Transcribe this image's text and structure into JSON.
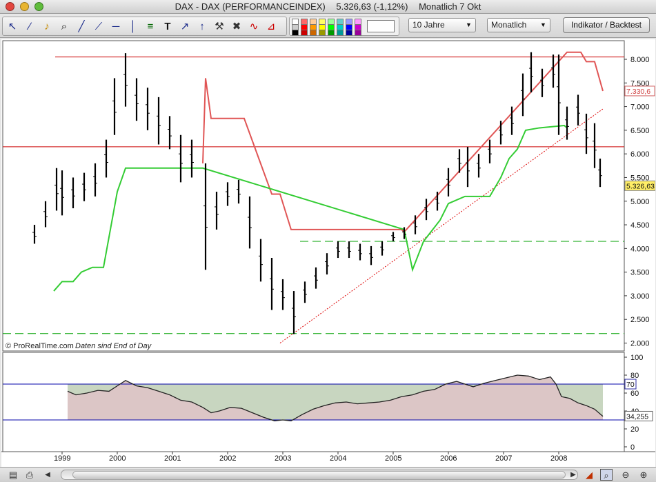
{
  "window": {
    "instrument": "DAX - DAX (PERFORMANCEINDEX)",
    "last_change": "5.326,63 (-1,12%)",
    "period_date": "Monatlich  7 Okt"
  },
  "toolbar": {
    "tools": [
      "cursor-icon",
      "ruler-icon",
      "alarm-bell-icon",
      "zoom-icon",
      "segment-icon",
      "trendline-icon",
      "horizontal-line-icon",
      "vertical-line-icon",
      "fibonacci-icon",
      "text-icon",
      "arrow-icon",
      "arrow-up-icon",
      "tools-icon",
      "trash-icon",
      "indicator-icon",
      "channel-icon"
    ],
    "swatch_colors": [
      "#ffffff",
      "#ff6666",
      "#ffcc99",
      "#ffff66",
      "#99ff99",
      "#66cccc",
      "#9999ff",
      "#ff99ff",
      "#cccccc",
      "#ff0000",
      "#ff9900",
      "#ffff00",
      "#00ff00",
      "#00cccc",
      "#0000ff",
      "#cc00cc",
      "#000000",
      "#cc0000",
      "#cc6600",
      "#999900",
      "#009900",
      "#009999",
      "#000099",
      "#990099"
    ],
    "range_select": "10 Jahre",
    "period_select": "Monatlich",
    "indicator_button": "Indikator / Backtest"
  },
  "chart_data": [
    {
      "type": "line",
      "title": "",
      "ylim": [
        2000,
        8300
      ],
      "y_ticks": [
        "2.000",
        "2.500",
        "3.000",
        "3.500",
        "4.000",
        "4.500",
        "5.000",
        "5.500",
        "6.000",
        "6.500",
        "7.000",
        "7.500",
        "8.000"
      ],
      "x_ticks": [
        "1999",
        "2000",
        "2001",
        "2002",
        "2003",
        "2004",
        "2005",
        "2006",
        "2007",
        "2008"
      ],
      "price_label": "5.326,63",
      "stop_label": "7.330,6",
      "watermark": "© ProRealTime.com",
      "note": "Daten sind End of Day",
      "colors": {
        "price": "#000000",
        "upper_stop": "#e05555",
        "lower_stop": "#33cc33",
        "resistance": "#cc0000",
        "support": "#00a000",
        "trend": "#dd0000"
      },
      "price_bars": [
        {
          "date": "1998.5",
          "high": 4500,
          "low": 4100
        },
        {
          "date": "1998.7",
          "high": 5000,
          "low": 4450
        },
        {
          "date": "1998.9",
          "high": 5700,
          "low": 4800
        },
        {
          "date": "1999.0",
          "high": 5650,
          "low": 4700
        },
        {
          "date": "1999.2",
          "high": 5500,
          "low": 4850
        },
        {
          "date": "1999.4",
          "high": 5600,
          "low": 5000
        },
        {
          "date": "1999.6",
          "high": 5800,
          "low": 5100
        },
        {
          "date": "1999.8",
          "high": 6300,
          "low": 5500
        },
        {
          "date": "1999.95",
          "high": 7600,
          "low": 6400
        },
        {
          "date": "2000.15",
          "high": 8130,
          "low": 7000
        },
        {
          "date": "2000.35",
          "high": 7600,
          "low": 6700
        },
        {
          "date": "2000.55",
          "high": 7400,
          "low": 6500
        },
        {
          "date": "2000.75",
          "high": 7200,
          "low": 6200
        },
        {
          "date": "2000.95",
          "high": 6800,
          "low": 6100
        },
        {
          "date": "2001.15",
          "high": 6400,
          "low": 5400
        },
        {
          "date": "2001.35",
          "high": 6300,
          "low": 5500
        },
        {
          "date": "2001.6",
          "high": 5800,
          "low": 3550
        },
        {
          "date": "2001.8",
          "high": 5200,
          "low": 4400
        },
        {
          "date": "2002.0",
          "high": 5400,
          "low": 4900
        },
        {
          "date": "2002.2",
          "high": 5450,
          "low": 4950
        },
        {
          "date": "2002.4",
          "high": 5100,
          "low": 4000
        },
        {
          "date": "2002.6",
          "high": 4200,
          "low": 3300
        },
        {
          "date": "2002.8",
          "high": 3800,
          "low": 2700
        },
        {
          "date": "2003.0",
          "high": 3350,
          "low": 2700
        },
        {
          "date": "2003.2",
          "high": 3100,
          "low": 2190
        },
        {
          "date": "2003.4",
          "high": 3300,
          "low": 2850
        },
        {
          "date": "2003.6",
          "high": 3600,
          "low": 3150
        },
        {
          "date": "2003.8",
          "high": 3900,
          "low": 3450
        },
        {
          "date": "2004.0",
          "high": 4150,
          "low": 3800
        },
        {
          "date": "2004.2",
          "high": 4150,
          "low": 3800
        },
        {
          "date": "2004.4",
          "high": 4100,
          "low": 3750
        },
        {
          "date": "2004.6",
          "high": 4050,
          "low": 3650
        },
        {
          "date": "2004.8",
          "high": 4150,
          "low": 3850
        },
        {
          "date": "2005.0",
          "high": 4350,
          "low": 4150
        },
        {
          "date": "2005.2",
          "high": 4450,
          "low": 4200
        },
        {
          "date": "2005.4",
          "high": 4700,
          "low": 4300
        },
        {
          "date": "2005.6",
          "high": 5050,
          "low": 4600
        },
        {
          "date": "2005.8",
          "high": 5200,
          "low": 4800
        },
        {
          "date": "2006.0",
          "high": 5700,
          "low": 5100
        },
        {
          "date": "2006.2",
          "high": 6100,
          "low": 5600
        },
        {
          "date": "2006.35",
          "high": 6150,
          "low": 5300
        },
        {
          "date": "2006.55",
          "high": 6000,
          "low": 5500
        },
        {
          "date": "2006.75",
          "high": 6300,
          "low": 5800
        },
        {
          "date": "2006.95",
          "high": 6700,
          "low": 6200
        },
        {
          "date": "2007.15",
          "high": 7000,
          "low": 6400
        },
        {
          "date": "2007.35",
          "high": 7700,
          "low": 6800
        },
        {
          "date": "2007.5",
          "high": 8150,
          "low": 7300
        },
        {
          "date": "2007.7",
          "high": 7800,
          "low": 7200
        },
        {
          "date": "2007.9",
          "high": 8100,
          "low": 7400
        },
        {
          "date": "2008.0",
          "high": 8100,
          "low": 6400
        },
        {
          "date": "2008.15",
          "high": 7000,
          "low": 6300
        },
        {
          "date": "2008.35",
          "high": 7250,
          "low": 6600
        },
        {
          "date": "2008.5",
          "high": 6850,
          "low": 6000
        },
        {
          "date": "2008.65",
          "high": 6650,
          "low": 5700
        },
        {
          "date": "2008.75",
          "high": 5900,
          "low": 5300
        }
      ],
      "upper_stop": [
        [
          "2001.55",
          5800
        ],
        [
          "2001.6",
          7600
        ],
        [
          "2001.7",
          6750
        ],
        [
          "2002.3",
          6750
        ],
        [
          "2002.8",
          5150
        ],
        [
          "2002.95",
          5150
        ],
        [
          "2003.15",
          4400
        ],
        [
          "2005.15",
          4400
        ],
        [
          "2005.2",
          4350
        ],
        [
          "2008.15",
          8150
        ],
        [
          "2008.4",
          8150
        ],
        [
          "2008.5",
          7950
        ],
        [
          "2008.65",
          7950
        ],
        [
          "2008.8",
          7330
        ]
      ],
      "lower_stop": [
        [
          "1998.85",
          3100
        ],
        [
          "1999.0",
          3300
        ],
        [
          "1999.2",
          3300
        ],
        [
          "1999.35",
          3500
        ],
        [
          "1999.55",
          3600
        ],
        [
          "1999.75",
          3600
        ],
        [
          "2000.0",
          5200
        ],
        [
          "2000.15",
          5700
        ],
        [
          "2001.55",
          5700
        ],
        [
          "2005.2",
          4400
        ],
        [
          "2005.35",
          3550
        ],
        [
          "2005.55",
          4150
        ],
        [
          "2005.85",
          4600
        ],
        [
          "2006.0",
          4950
        ],
        [
          "2006.3",
          5100
        ],
        [
          "2006.75",
          5100
        ],
        [
          "2006.95",
          5500
        ],
        [
          "2007.1",
          5900
        ],
        [
          "2007.25",
          6100
        ],
        [
          "2007.4",
          6500
        ],
        [
          "2007.65",
          6550
        ],
        [
          "2008.1",
          6600
        ],
        [
          "2008.15",
          6550
        ]
      ],
      "resistance_lines": [
        8050,
        6150
      ],
      "support_lines": [
        4150,
        2200
      ],
      "trendline": [
        [
          "2002.95",
          2000
        ],
        [
          "2008.8",
          6950
        ]
      ]
    },
    {
      "type": "area",
      "title": "",
      "ylim": [
        0,
        100
      ],
      "y_ticks": [
        "0",
        "20",
        "40",
        "60",
        "80",
        "100"
      ],
      "levels": [
        70,
        30
      ],
      "level_label": "70",
      "value_label": "34,255",
      "colors": {
        "line": "#222222",
        "above": "#c8d6c0",
        "below": "#dcc6c6",
        "level": "#0000aa"
      },
      "values": [
        [
          "1999.1",
          62
        ],
        [
          "1999.25",
          58
        ],
        [
          "1999.45",
          60
        ],
        [
          "1999.65",
          63
        ],
        [
          "1999.85",
          62
        ],
        [
          "2000.05",
          70
        ],
        [
          "2000.15",
          74
        ],
        [
          "2000.35",
          68
        ],
        [
          "2000.55",
          66
        ],
        [
          "2000.75",
          62
        ],
        [
          "2000.95",
          58
        ],
        [
          "2001.15",
          52
        ],
        [
          "2001.35",
          50
        ],
        [
          "2001.55",
          44
        ],
        [
          "2001.7",
          38
        ],
        [
          "2001.85",
          40
        ],
        [
          "2002.05",
          44
        ],
        [
          "2002.25",
          43
        ],
        [
          "2002.45",
          38
        ],
        [
          "2002.65",
          33
        ],
        [
          "2002.85",
          29
        ],
        [
          "2003.0",
          30
        ],
        [
          "2003.15",
          29
        ],
        [
          "2003.35",
          36
        ],
        [
          "2003.55",
          42
        ],
        [
          "2003.75",
          46
        ],
        [
          "2003.95",
          49
        ],
        [
          "2004.15",
          50
        ],
        [
          "2004.35",
          48
        ],
        [
          "2004.55",
          49
        ],
        [
          "2004.75",
          50
        ],
        [
          "2004.95",
          52
        ],
        [
          "2005.15",
          56
        ],
        [
          "2005.35",
          58
        ],
        [
          "2005.55",
          62
        ],
        [
          "2005.75",
          64
        ],
        [
          "2005.95",
          70
        ],
        [
          "2006.15",
          73
        ],
        [
          "2006.3",
          70
        ],
        [
          "2006.45",
          67
        ],
        [
          "2006.65",
          71
        ],
        [
          "2006.85",
          74
        ],
        [
          "2007.05",
          77
        ],
        [
          "2007.25",
          80
        ],
        [
          "2007.45",
          79
        ],
        [
          "2007.65",
          75
        ],
        [
          "2007.85",
          78
        ],
        [
          "2007.95",
          70
        ],
        [
          "2008.05",
          56
        ],
        [
          "2008.2",
          54
        ],
        [
          "2008.35",
          49
        ],
        [
          "2008.5",
          46
        ],
        [
          "2008.65",
          42
        ],
        [
          "2008.8",
          34
        ]
      ]
    }
  ],
  "bottom_bar": {
    "icons": [
      "print-preview-icon",
      "print-icon",
      "scroll-left-icon",
      "scroll-right-icon",
      "resize-icon",
      "zoom-out-icon",
      "zoom-in-icon"
    ]
  }
}
